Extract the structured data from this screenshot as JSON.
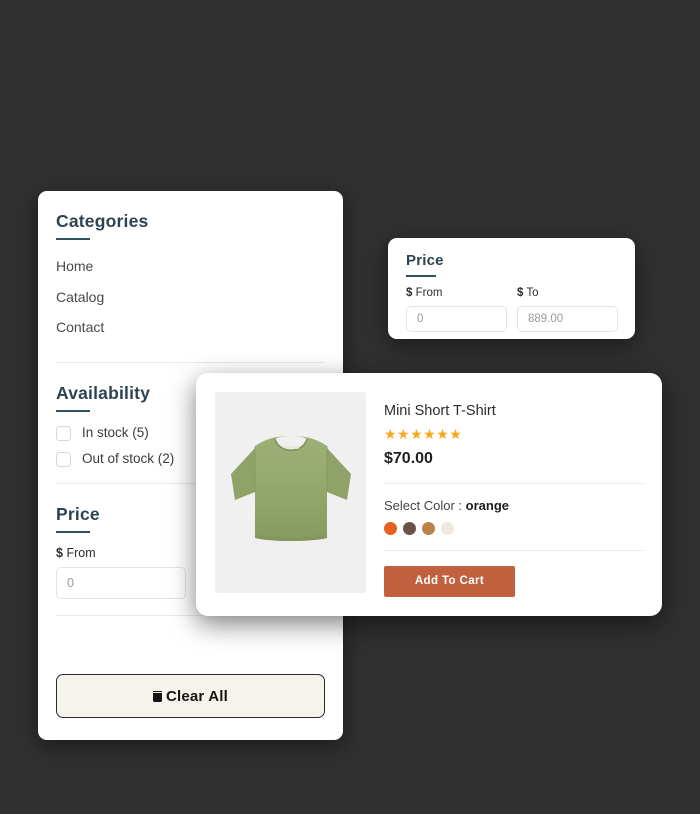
{
  "theme": {
    "page_background": "#303030",
    "heading_color": "#2e4352",
    "accent_button": "#c0603f",
    "star_color": "#f9a81a",
    "clear_button_background": "#f6f2ec"
  },
  "filter_panel": {
    "categories": {
      "title": "Categories",
      "items": [
        {
          "label": "Home"
        },
        {
          "label": "Catalog"
        },
        {
          "label": "Contact"
        }
      ]
    },
    "availability": {
      "title": "Availability",
      "options": [
        {
          "label": "In stock (5)",
          "checked": false
        },
        {
          "label": "Out of stock (2)",
          "checked": false
        }
      ]
    },
    "price": {
      "title": "Price",
      "from_label_currency": "$",
      "from_label": "From",
      "from_value": "0",
      "to_label_currency": "$",
      "to_label": "To",
      "to_value": ""
    },
    "clear_all_label": "Clear All"
  },
  "price_popup": {
    "title": "Price",
    "from_label_currency": "$",
    "from_label": "From",
    "from_value": "0",
    "to_label_currency": "$",
    "to_label": "To",
    "to_value": "889.00"
  },
  "product_card": {
    "title": "Mini Short T-Shirt",
    "rating_stars": "★★★★★★",
    "rating_count": 6,
    "price": "$70.00",
    "color_label": "Select Color :",
    "selected_color": "orange",
    "swatches": [
      {
        "name": "orange",
        "hex": "#e8601e"
      },
      {
        "name": "dark-brown",
        "hex": "#6b5248"
      },
      {
        "name": "tan",
        "hex": "#b9824b"
      },
      {
        "name": "cream",
        "hex": "#efe9e0"
      }
    ],
    "add_to_cart_label": "Add To Cart",
    "image_alt": "sage green short sleeve crop t-shirt"
  }
}
